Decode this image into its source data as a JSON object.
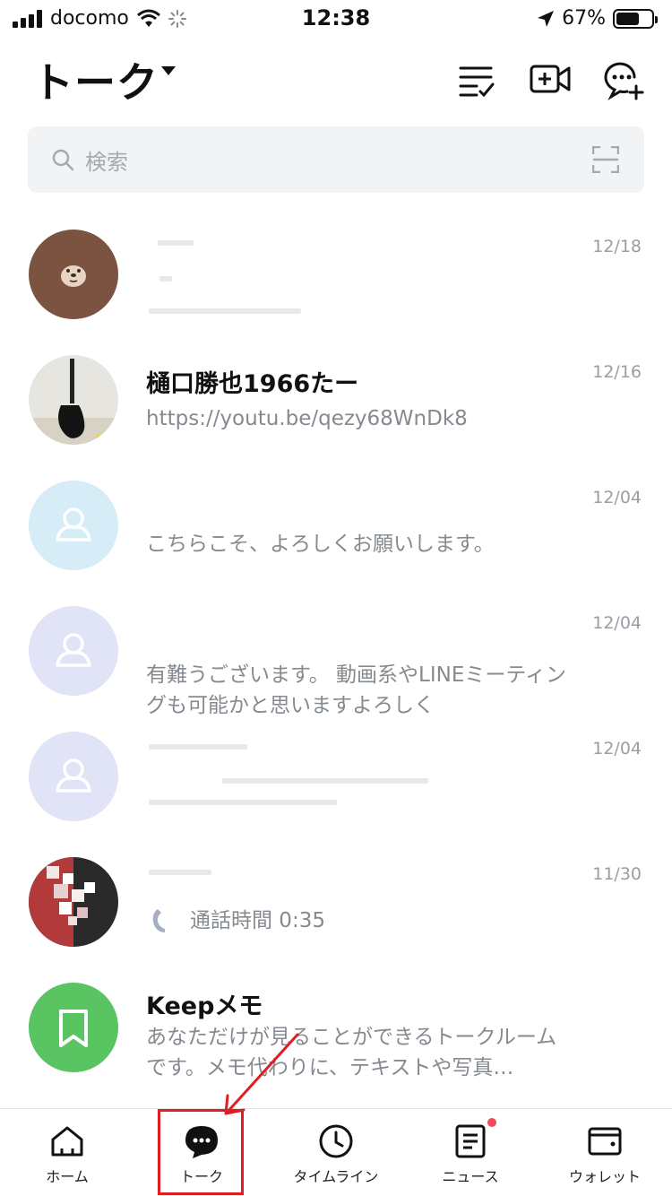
{
  "status_bar": {
    "carrier": "docomo",
    "time": "12:38",
    "battery": "67%",
    "battery_level": 0.67
  },
  "header": {
    "title": "トーク"
  },
  "search": {
    "placeholder": "検索"
  },
  "chats": [
    {
      "name": "",
      "preview": "",
      "date": "12/18",
      "avatar": "brown-bear-avatar"
    },
    {
      "name": "樋口勝也1966たー",
      "preview": "https://youtu.be/qezy68WnDk8",
      "date": "12/16",
      "avatar": "guitar-photo-avatar"
    },
    {
      "name": "",
      "preview": "こちらこそ、よろしくお願いします。",
      "date": "12/04",
      "avatar": "default-person-avatar",
      "avatar_color": "#d6ecf7"
    },
    {
      "name": "",
      "preview": "有難うございます。 動画系やLINEミーティングも可能かと思いますよろしく",
      "date": "12/04",
      "avatar": "default-person-avatar",
      "avatar_color": "#e1e3f7"
    },
    {
      "name": "",
      "preview": "",
      "date": "12/04",
      "avatar": "default-person-avatar",
      "avatar_color": "#e1e3f7"
    },
    {
      "name": "",
      "preview": "通話時間 0:35",
      "date": "11/30",
      "avatar": "mosaic-photo-avatar"
    },
    {
      "name": "Keepメモ",
      "preview": "あなただけが見ることができるトークルームです。メモ代わりに、テキストや写真…",
      "date": "",
      "avatar": "keep-bookmark-avatar",
      "avatar_color": "#5ac463"
    }
  ],
  "nav": [
    {
      "label": "ホーム",
      "icon": "home-icon"
    },
    {
      "label": "トーク",
      "icon": "chat-icon",
      "active": true
    },
    {
      "label": "タイムライン",
      "icon": "clock-icon"
    },
    {
      "label": "ニュース",
      "icon": "news-icon",
      "badge": true
    },
    {
      "label": "ウォレット",
      "icon": "wallet-icon"
    }
  ],
  "colors": {
    "accent_red": "#e21c23",
    "keep_green": "#5ac463",
    "badge_red": "#f04a5e"
  }
}
